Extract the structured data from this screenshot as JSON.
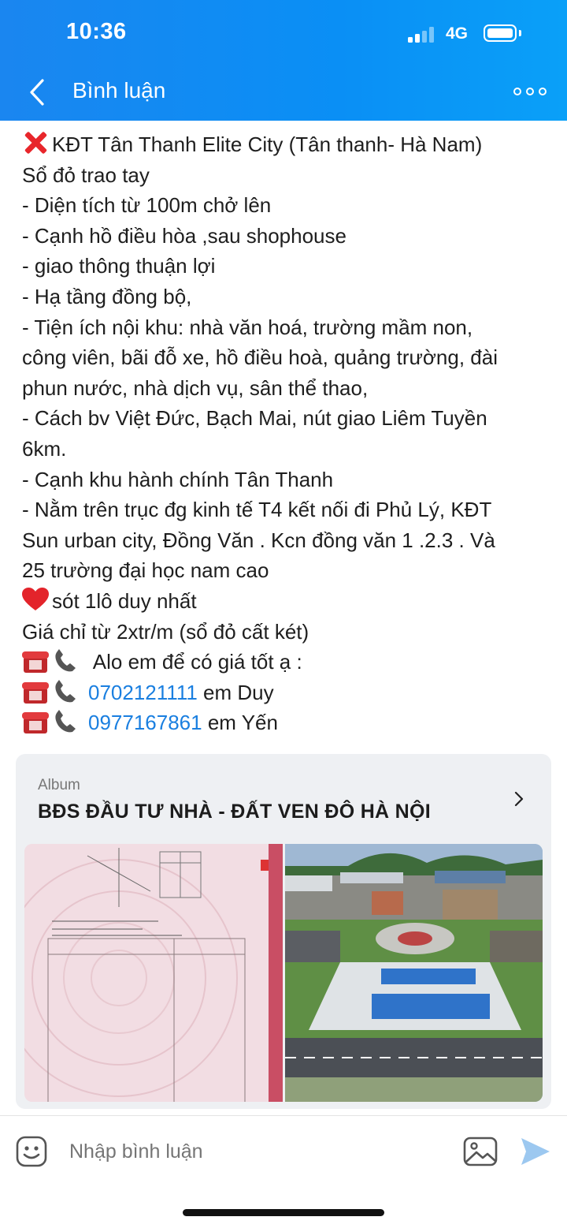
{
  "status_bar": {
    "time": "10:36",
    "network": "4G"
  },
  "header": {
    "title": "Bình luận",
    "back_icon": "chevron-left-icon",
    "more_icon": "more-options-icon"
  },
  "post": {
    "lines": [
      {
        "emoji": "red-x",
        "text": "KĐT Tân Thanh Elite City (Tân thanh- Hà Nam)"
      },
      {
        "text": "Sổ đỏ trao tay"
      },
      {
        "text": "- Diện tích từ 100m chở lên"
      },
      {
        "text": "- Cạnh hồ điều hòa ,sau shophouse"
      },
      {
        "text": "- giao thông thuận lợi"
      },
      {
        "text": "- Hạ tầng đồng bộ,"
      },
      {
        "text": "- Tiện ích nội khu: nhà văn hoá, trường mầm non,"
      },
      {
        "text": "công viên, bãi đỗ xe, hồ điều hoà, quảng trường, đài"
      },
      {
        "text": "phun nước, nhà dịch vụ, sân thể thao,"
      },
      {
        "text": "- Cách bv Việt Đức, Bạch Mai, nút giao Liêm Tuyền"
      },
      {
        "text": "6km."
      },
      {
        "text": "- Cạnh khu hành chính Tân Thanh"
      },
      {
        "text": "- Nằm trên trục đg kinh tế T4 kết nối đi Phủ Lý, KĐT"
      },
      {
        "text": "Sun urban city, Đồng Văn . Kcn đồng văn 1 .2.3 . Và"
      },
      {
        "text": "25 trường đại học nam cao"
      },
      {
        "emoji": "heart",
        "text": "sót 1lô duy nhất"
      },
      {
        "text": "Giá chỉ từ 2xtr/m (sổ đỏ cất két)"
      },
      {
        "emoji": "phones",
        "text": " Alo em để có giá tốt ạ :"
      }
    ],
    "contacts": [
      {
        "phone": "0702121111",
        "name": " em Duy"
      },
      {
        "phone": "0977167861",
        "name": " em Yến"
      }
    ]
  },
  "album": {
    "label": "Album",
    "title": "BĐS ĐẦU TƯ NHÀ - ĐẤT VEN ĐÔ  HÀ NỘI"
  },
  "composer": {
    "placeholder": "Nhập bình luận"
  }
}
